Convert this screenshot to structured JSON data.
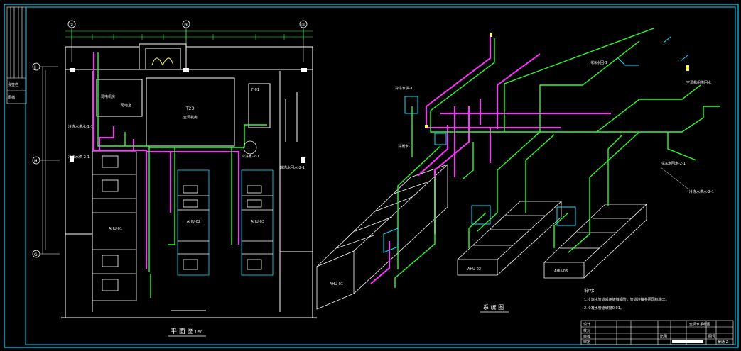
{
  "plan": {
    "title": "平 面 图",
    "scale": "1:50",
    "grid_axes": [
      "②",
      "③",
      "④",
      "J",
      "H",
      "G"
    ],
    "rooms": [
      {
        "name": "T23",
        "sub": "空调机房"
      },
      {
        "name": "弱电机房"
      },
      {
        "name": "配电室"
      },
      {
        "name": "F-01"
      }
    ],
    "units": [
      "AHU-01",
      "AHU-02",
      "AHU-03"
    ],
    "callouts": [
      "冷冻水供水-1-1",
      "冷冻水供-2-1",
      "冷冻水-2-1",
      "冷冻水回水-2-1"
    ]
  },
  "iso": {
    "title": "系 统 图",
    "units": [
      "AHU-01",
      "AHU-02",
      "AHU-03"
    ],
    "callouts": [
      "冷冻水供-1",
      "冷冻水回-1",
      "空调机组供回水",
      "冷冻水回水-2-1",
      "冷冻水供水-2-1",
      "冷凝水-1"
    ],
    "notes_title": "说明：",
    "notes": [
      "1.冷冻水管道采用镀锌钢管，管道连接参照国标施工。",
      "2.冷凝水管道坡度0.01。"
    ]
  },
  "titleblock": {
    "drawing_name": "空调水系统图",
    "labels": [
      "设计",
      "校对",
      "审核",
      "审定",
      "比例",
      "图号"
    ],
    "drawing_no": "暖通-2"
  },
  "colors": {
    "border": "#00d7ff",
    "magenta": "#ff33ff",
    "green": "#2aff2a",
    "cyan": "#00e5ff",
    "white": "#ffffff",
    "yellow": "#ffff55"
  }
}
